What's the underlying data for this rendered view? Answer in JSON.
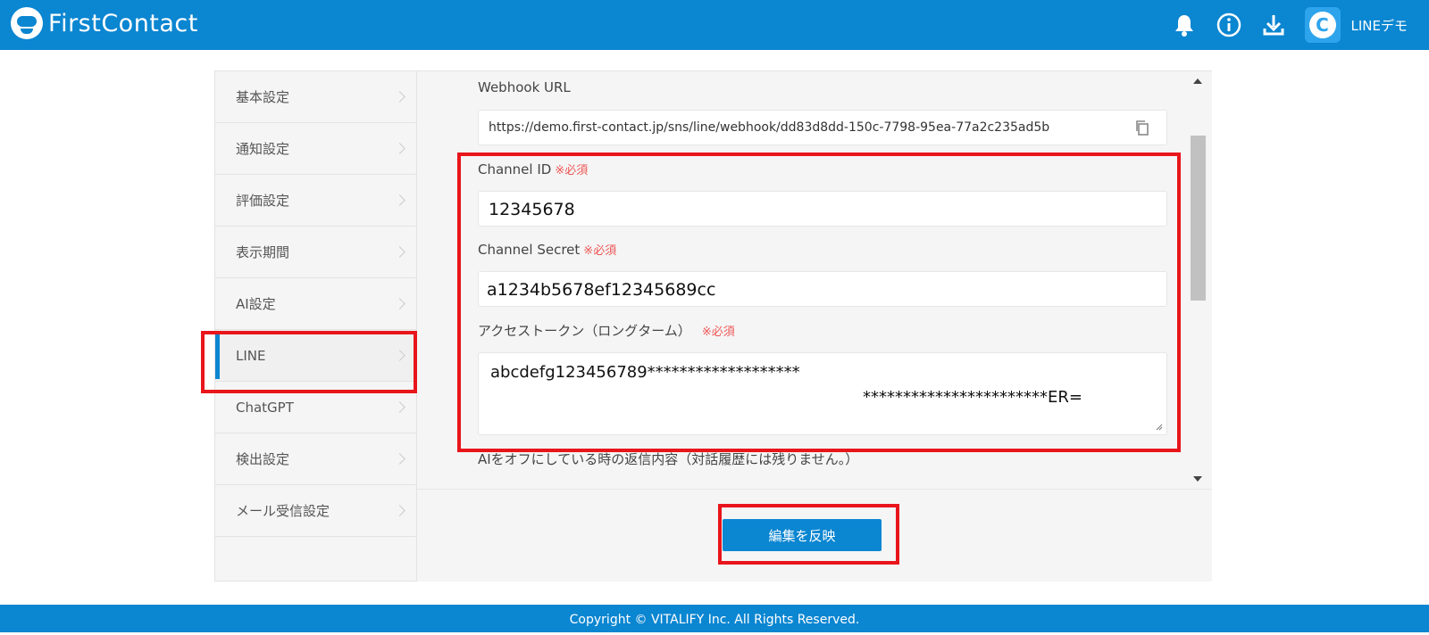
{
  "header": {
    "brand": "FirstContact",
    "user_name": "LINEデモ",
    "avatar_letter": "C",
    "icons": [
      "bell-icon",
      "info-icon",
      "download-icon"
    ]
  },
  "sidebar": {
    "items": [
      {
        "label": "基本設定"
      },
      {
        "label": "通知設定"
      },
      {
        "label": "評価設定"
      },
      {
        "label": "表示期間"
      },
      {
        "label": "AI設定"
      },
      {
        "label": "LINE",
        "active": true
      },
      {
        "label": "ChatGPT"
      },
      {
        "label": "検出設定"
      },
      {
        "label": "メール受信設定"
      }
    ]
  },
  "form": {
    "webhook": {
      "label": "Webhook URL",
      "value": "https://demo.first-contact.jp/sns/line/webhook/dd83d8dd-150c-7798-95ea-77a2c235ad5b"
    },
    "channel_id": {
      "label": "Channel ID",
      "required": "※必須",
      "value": "12345678"
    },
    "channel_secret": {
      "label": "Channel Secret",
      "required": "※必須",
      "value": "a1234b5678ef12345689cc"
    },
    "access_token": {
      "label": "アクセストークン（ロングターム）",
      "required": "※必須",
      "line1": "abcdefg123456789*******************",
      "line2": "***********************ER="
    },
    "ai_off_reply_label": "AIをオフにしている時の返信内容（対話履歴には残りません。）"
  },
  "actions": {
    "apply_label": "編集を反映"
  },
  "footer": {
    "copyright": "Copyright © VITALIFY Inc. All Rights Reserved."
  },
  "colors": {
    "brand_blue": "#0b86d1",
    "highlight_red": "#e8151b",
    "required_red": "#ee5555"
  }
}
